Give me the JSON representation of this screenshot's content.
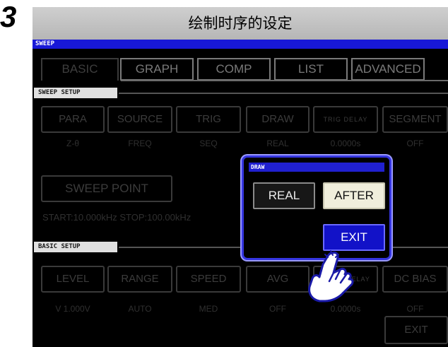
{
  "step_number": "3",
  "page_title": "绘制时序的设定",
  "screen_title": "SWEEP",
  "tabs": [
    "BASIC",
    "GRAPH",
    "COMP",
    "LIST",
    "ADVANCED"
  ],
  "sweep_setup": {
    "section_label": "SWEEP SETUP",
    "buttons": [
      "PARA",
      "SOURCE",
      "TRIG",
      "DRAW",
      "TRIG DELAY",
      "SEGMENT"
    ],
    "values": [
      "Z-θ",
      "FREQ",
      "SEQ",
      "REAL",
      "0.0000s",
      "OFF"
    ],
    "sweep_point_button": "SWEEP POINT",
    "range_text": "START:10.000kHz STOP:100.00kHz"
  },
  "basic_setup": {
    "section_label": "BASIC SETUP",
    "buttons": [
      "LEVEL",
      "RANGE",
      "SPEED",
      "AVG",
      "POINT DELAY",
      "DC BIAS"
    ],
    "values": [
      "V 1.000V",
      "AUTO",
      "MED",
      "OFF",
      "0.0000s",
      "OFF"
    ],
    "exit_button": "EXIT"
  },
  "draw_popup": {
    "title": "DRAW",
    "real_label": "REAL",
    "after_label": "AFTER",
    "exit_label": "EXIT",
    "selected": "AFTER"
  },
  "colors": {
    "title_bar": "#bfbfbf",
    "header_blue": "#1818d8",
    "popup_border": "#3535e0",
    "selected_button": "#f0eedc",
    "exit_button": "#1212c8"
  },
  "icons": {
    "pointer": "hand-pointer-icon"
  }
}
